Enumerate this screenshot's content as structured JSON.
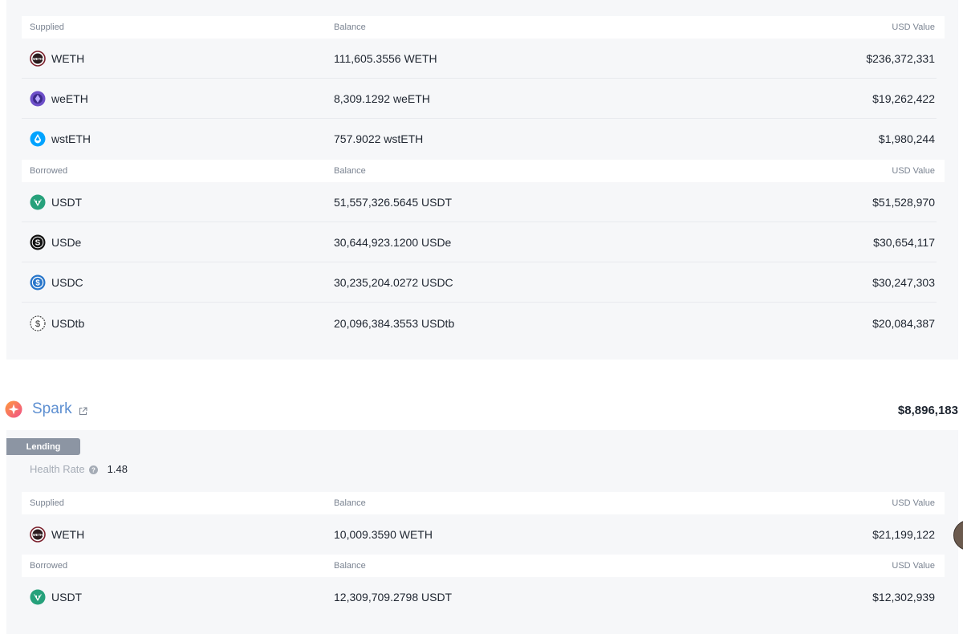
{
  "top_section": {
    "supplied_header": {
      "label": "Supplied",
      "balance": "Balance",
      "usd": "USD Value"
    },
    "supplied": [
      {
        "token": "WETH",
        "icon": "weth-icon",
        "balance": "111,605.3556 WETH",
        "usd": "$236,372,331"
      },
      {
        "token": "weETH",
        "icon": "weeth-icon",
        "balance": "8,309.1292 weETH",
        "usd": "$19,262,422"
      },
      {
        "token": "wstETH",
        "icon": "wsteth-icon",
        "balance": "757.9022 wstETH",
        "usd": "$1,980,244"
      }
    ],
    "borrowed_header": {
      "label": "Borrowed",
      "balance": "Balance",
      "usd": "USD Value"
    },
    "borrowed": [
      {
        "token": "USDT",
        "icon": "usdt-icon",
        "balance": "51,557,326.5645 USDT",
        "usd": "$51,528,970"
      },
      {
        "token": "USDe",
        "icon": "usde-icon",
        "balance": "30,644,923.1200 USDe",
        "usd": "$30,654,117"
      },
      {
        "token": "USDC",
        "icon": "usdc-icon",
        "balance": "30,235,204.0272 USDC",
        "usd": "$30,247,303"
      },
      {
        "token": "USDtb",
        "icon": "usdtb-icon",
        "balance": "20,096,384.3553 USDtb",
        "usd": "$20,084,387"
      }
    ]
  },
  "spark": {
    "name": "Spark",
    "total": "$8,896,183",
    "tag": "Lending",
    "health_label": "Health Rate",
    "health_value": "1.48",
    "supplied_header": {
      "label": "Supplied",
      "balance": "Balance",
      "usd": "USD Value"
    },
    "supplied": [
      {
        "token": "WETH",
        "icon": "weth-icon",
        "balance": "10,009.3590 WETH",
        "usd": "$21,199,122"
      }
    ],
    "borrowed_header": {
      "label": "Borrowed",
      "balance": "Balance",
      "usd": "USD Value"
    },
    "borrowed": [
      {
        "token": "USDT",
        "icon": "usdt-icon",
        "balance": "12,309,709.2798 USDT",
        "usd": "$12,302,939"
      }
    ]
  },
  "colors": {
    "panel_bg": "#f6f7f9",
    "spark_link": "#5d8fd1",
    "tag_bg": "#8c95a3",
    "usdt": "#26a17b",
    "usdc": "#2775ca",
    "weeth": "#6d4fc9",
    "wsteth": "#00a3ff"
  }
}
